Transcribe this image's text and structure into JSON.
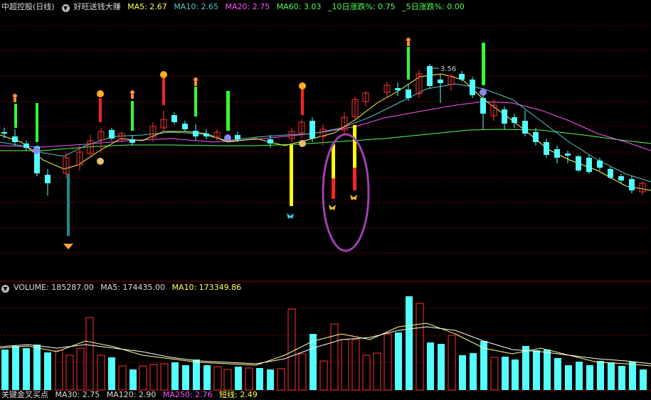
{
  "header": {
    "stock": "中超控股(日线)",
    "indicator": "好旺送钱大赚",
    "ma5": "MA5: 2.67",
    "ma10": "MA10: 2.65",
    "ma20": "MA20: 2.75",
    "ma60": "MA60: 3.03",
    "chg10": "_10日涨跌%: 0.75",
    "chg5": "_5日涨跌%: 0.00"
  },
  "price_label": "3.56",
  "volume_header": {
    "volume": "VOLUME: 185287.00",
    "ma5": "MA5: 174435.00",
    "ma10": "MA10: 173349.86"
  },
  "bottom_header": {
    "name": "关键金叉买点",
    "ma30": "MA30: 2.75",
    "ma120": "MA120: 2.90",
    "ma250": "MA250: 2.76",
    "short": "短线: 2.49"
  },
  "colors": {
    "up": "#ff3232",
    "down": "#54ffff",
    "ma5": "#ffff54",
    "ma10": "#54c8c8",
    "ma20": "#ff54ff",
    "ma60": "#54ff54",
    "grid": "#8b0000"
  },
  "icons": [
    "arrow-up-icon",
    "settings-icon",
    "peach-icon",
    "runner-icon",
    "face-icon",
    "money-bag-icon",
    "diamond-icon",
    "butterfly-icon"
  ]
}
